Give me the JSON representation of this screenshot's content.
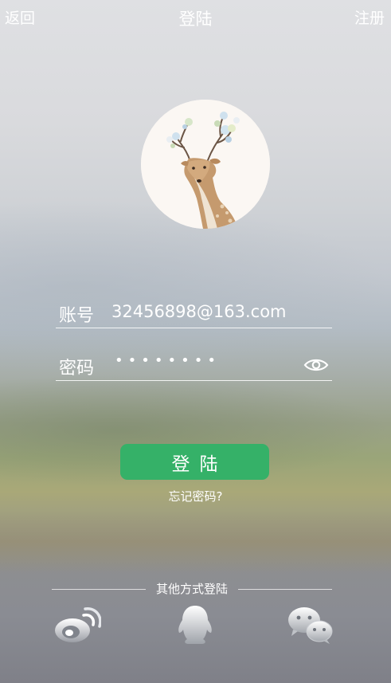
{
  "header": {
    "back_label": "返回",
    "title": "登陆",
    "register_label": "注册"
  },
  "form": {
    "account_label": "账号",
    "account_value": "32456898@163.com",
    "password_label": "密码",
    "password_masked": "••••••••",
    "eye_icon": "eye-icon"
  },
  "actions": {
    "login_label": "登陆",
    "forgot_label": "忘记密码?"
  },
  "other_login": {
    "label": "其他方式登陆",
    "icons": [
      "weibo-icon",
      "qq-icon",
      "wechat-icon"
    ]
  },
  "colors": {
    "login_button": "#35b168",
    "text": "#ffffff"
  }
}
